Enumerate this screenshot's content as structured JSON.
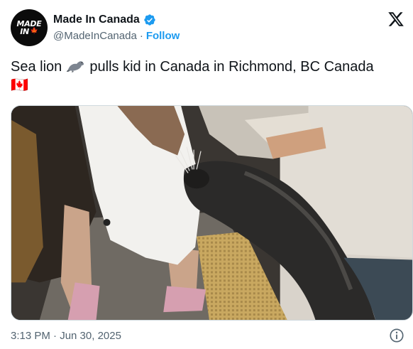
{
  "author": {
    "display_name": "Made In Canada",
    "handle": "@MadeInCanada",
    "follow_label": "Follow",
    "separator": "·",
    "avatar_text_line1": "MADE",
    "avatar_text_line2": "IN"
  },
  "tweet": {
    "text_before_emoji": "Sea lion ",
    "text_after_emoji": " pulls kid in Canada in Richmond, BC Canada",
    "flag": "🇨🇦"
  },
  "media": {
    "type": "video-thumbnail"
  },
  "footer": {
    "timestamp": "3:13 PM · Jun 30, 2025"
  },
  "icons": {
    "verified": "verified-badge-icon",
    "x_logo": "x-logo-icon",
    "info": "info-icon",
    "seal_emoji": "seal-emoji-icon",
    "maple_leaf": "maple-leaf-icon"
  },
  "colors": {
    "accent": "#1d9bf0",
    "text": "#0f1419",
    "secondary_text": "#536471",
    "border": "#cfd9de"
  }
}
